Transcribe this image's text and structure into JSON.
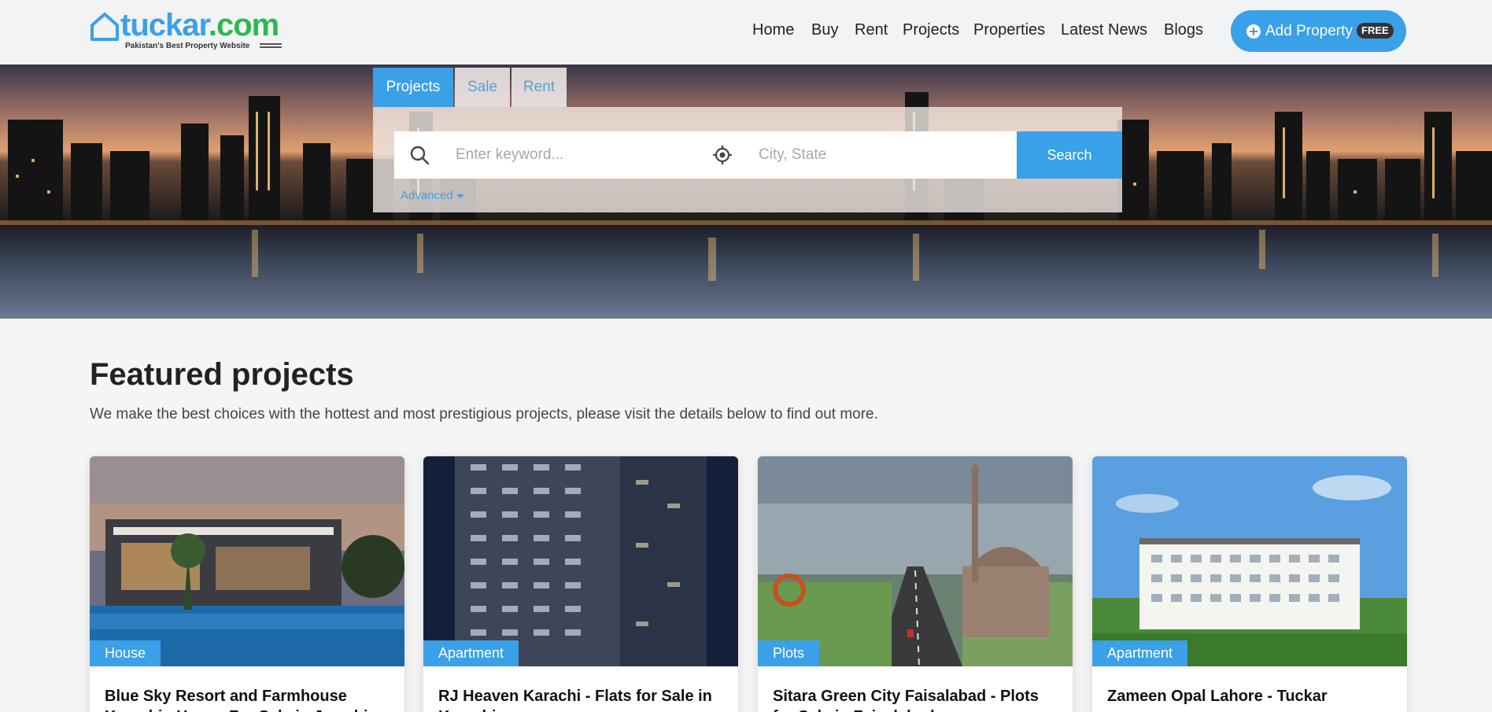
{
  "brand": {
    "name_part1": "tuckar",
    "name_part2": ".com",
    "tagline": "Pakistan's Best Property Website"
  },
  "nav": {
    "items": [
      {
        "label": "Home",
        "active": true
      },
      {
        "label": "Buy",
        "active": false
      },
      {
        "label": "Rent",
        "active": false
      },
      {
        "label": "Projects",
        "active": false
      },
      {
        "label": "Properties",
        "active": false
      },
      {
        "label": "Latest News",
        "active": false
      },
      {
        "label": "Blogs",
        "active": false
      }
    ],
    "add_property_label": "Add Property",
    "add_property_badge": "FREE"
  },
  "search": {
    "tabs": [
      {
        "label": "Projects",
        "active": true
      },
      {
        "label": "Sale",
        "active": false
      },
      {
        "label": "Rent",
        "active": false
      }
    ],
    "keyword_placeholder": "Enter keyword...",
    "city_placeholder": "City, State",
    "search_label": "Search",
    "advanced_label": "Advanced"
  },
  "featured": {
    "title": "Featured projects",
    "subtitle": "We make the best choices with the hottest and most prestigious projects, please visit the details below to find out more.",
    "cards": [
      {
        "tag": "House",
        "title": "Blue Sky Resort and Farmhouse Karachi - House For Sale in Jamshi"
      },
      {
        "tag": "Apartment",
        "title": "RJ Heaven Karachi - Flats for Sale in Karachi"
      },
      {
        "tag": "Plots",
        "title": "Sitara Green City Faisalabad - Plots for Sale in Faisalabad"
      },
      {
        "tag": "Apartment",
        "title": "Zameen Opal Lahore - Tuckar"
      }
    ]
  },
  "colors": {
    "accent": "#3aa0e8",
    "brand_green": "#2db84d",
    "header_bg": "#f1f3f5",
    "page_bg": "#f5f5f5"
  },
  "icons": {
    "search": "search-icon",
    "location": "locate-icon",
    "add": "plus-circle-icon",
    "caret": "caret-down-icon"
  }
}
